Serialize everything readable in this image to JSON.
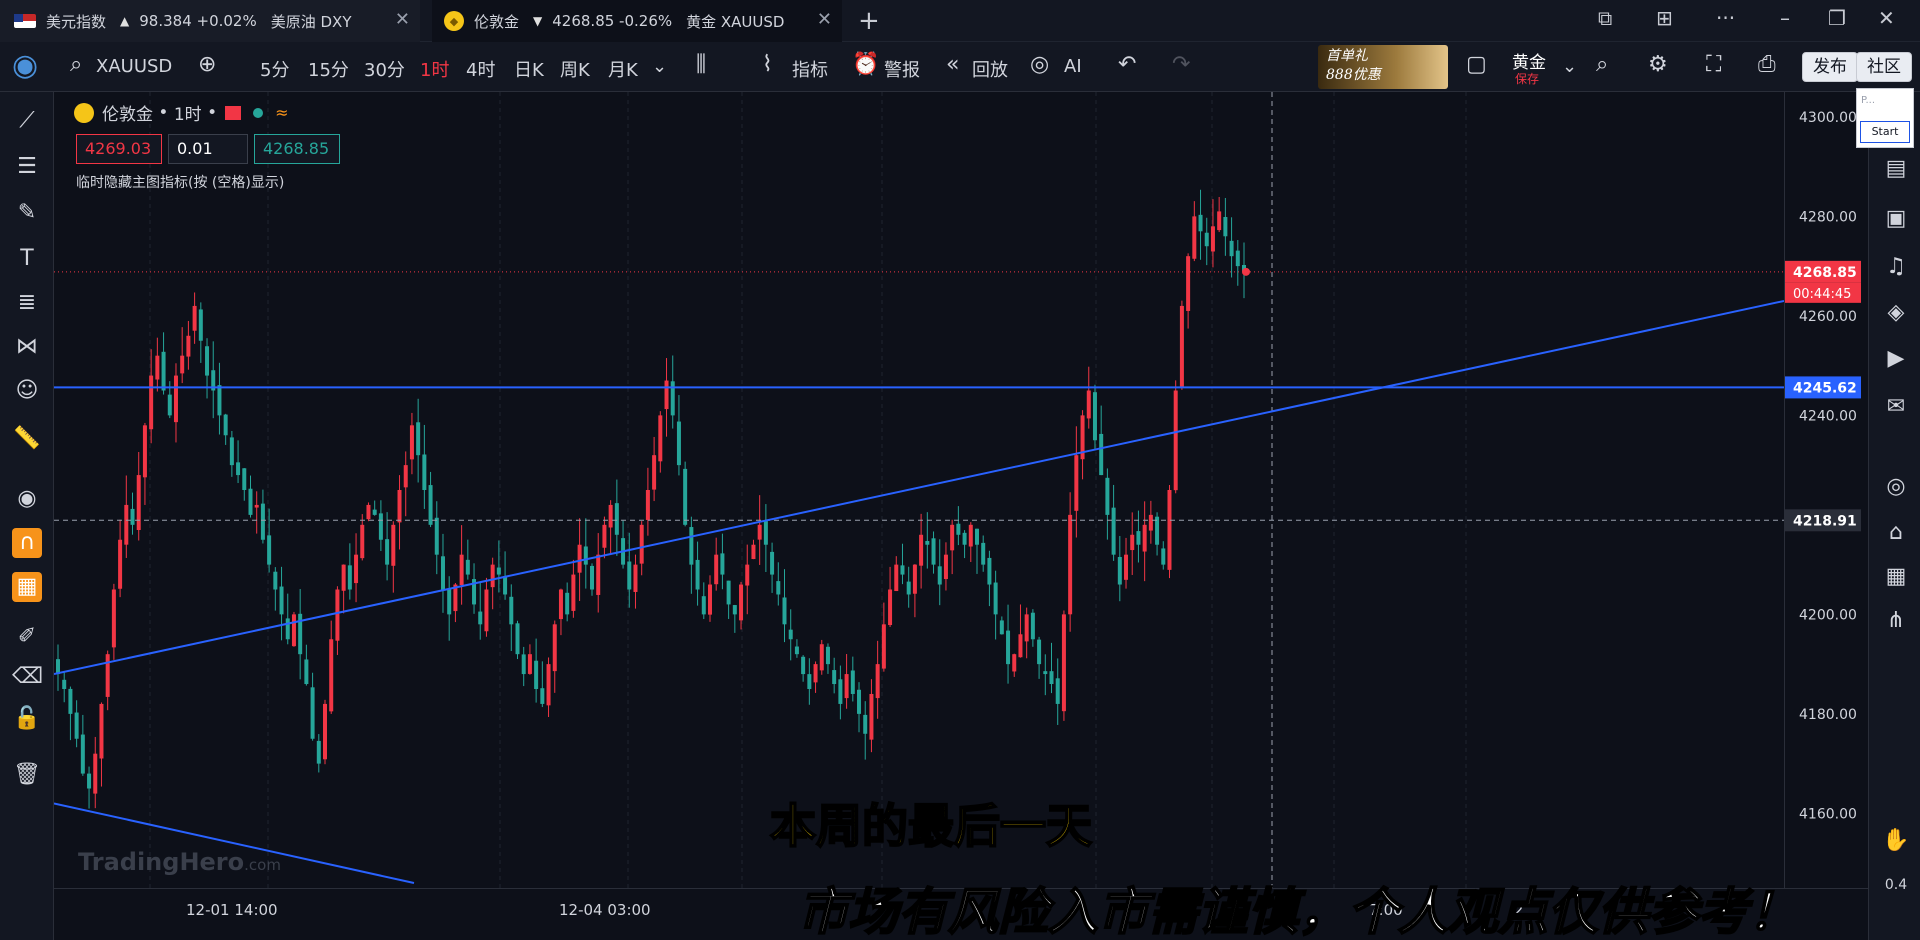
{
  "tabs": [
    {
      "title": "美元指数",
      "arrow": "▲",
      "quote": "98.384 +0.02%",
      "extra": "美原油 DXY"
    },
    {
      "title": "伦敦金",
      "arrow": "▼",
      "quote": "4268.85 -0.26%",
      "extra": "黄金 XAUUSD"
    }
  ],
  "toolbar": {
    "symbol": "XAUUSD",
    "intervals": [
      "5分",
      "15分",
      "30分",
      "1时",
      "4时",
      "日K",
      "周K",
      "月K"
    ],
    "active_interval": "1时",
    "indicators_label": "指标",
    "alerts_label": "警报",
    "replay_label": "回放",
    "ai_label": "AI",
    "promo_line1": "首单礼",
    "promo_line2": "888优惠",
    "layout_name": "黄金",
    "layout_save": "保存",
    "publish_label": "发布",
    "community_label": "社区"
  },
  "legend": {
    "name": "伦敦金",
    "interval": "1时",
    "bid": "4269.03",
    "qty": "0.01",
    "ask": "4268.85",
    "hint": "临时隐藏主图指标(按 (空格)显示)"
  },
  "price_axis": {
    "ticks": [
      "4300.00",
      "4280.00",
      "4260.00",
      "4240.00",
      "4200.00",
      "4180.00",
      "4160.00"
    ],
    "last_price": "4268.85",
    "countdown": "00:44:45",
    "hline_price": "4245.62",
    "crosshair_price": "4218.91"
  },
  "time_axis": {
    "labels": [
      "12-01 14:00",
      "12-04 03:00",
      "7:00",
      "2"
    ]
  },
  "subtitle_yellow": "本周的最后一天",
  "subtitle_white": "市场有风险入市需谨慎，个人观点仅供参考！",
  "watermark": {
    "brand": "TradingHero",
    "suffix": ".com"
  },
  "start_widget": {
    "label": "Start",
    "placeholder": "P..."
  },
  "corner_value": "0.4",
  "colors": {
    "up": "#f23645",
    "down": "#26a69a",
    "trendline": "#2962ff",
    "background": "#0d1019"
  },
  "chart_data": {
    "type": "candlestick",
    "symbol": "XAUUSD",
    "interval": "1H",
    "ylim": [
      4145,
      4305
    ],
    "current_price": 4268.85,
    "horizontal_line": 4245.62,
    "crosshair": 4218.91,
    "x_labels": [
      "12-01 14:00",
      "12-04 03:00"
    ],
    "close_path": [
      4188,
      4185,
      4180,
      4175,
      4168,
      4165,
      4172,
      4182,
      4192,
      4205,
      4215,
      4222,
      4218,
      4228,
      4238,
      4248,
      4252,
      4245,
      4240,
      4248,
      4252,
      4256,
      4262,
      4255,
      4248,
      4245,
      4240,
      4236,
      4230,
      4228,
      4225,
      4220,
      4222,
      4215,
      4210,
      4205,
      4200,
      4195,
      4200,
      4192,
      4186,
      4175,
      4170,
      4182,
      4195,
      4205,
      4210,
      4205,
      4212,
      4218,
      4222,
      4220,
      4215,
      4210,
      4218,
      4225,
      4230,
      4238,
      4232,
      4225,
      4218,
      4212,
      4205,
      4200,
      4206,
      4212,
      4208,
      4202,
      4198,
      4205,
      4210,
      4208,
      4204,
      4198,
      4192,
      4188,
      4192,
      4185,
      4182,
      4190,
      4198,
      4205,
      4200,
      4208,
      4214,
      4210,
      4205,
      4212,
      4218,
      4222,
      4216,
      4210,
      4205,
      4210,
      4218,
      4225,
      4232,
      4240,
      4247,
      4240,
      4230,
      4218,
      4210,
      4205,
      4200,
      4206,
      4212,
      4208,
      4202,
      4200,
      4206,
      4210,
      4214,
      4218,
      4214,
      4208,
      4204,
      4198,
      4195,
      4192,
      4188,
      4185,
      4190,
      4194,
      4190,
      4186,
      4182,
      4188,
      4184,
      4180,
      4176,
      4184,
      4190,
      4198,
      4205,
      4210,
      4208,
      4204,
      4210,
      4216,
      4214,
      4210,
      4206,
      4212,
      4218,
      4216,
      4214,
      4218,
      4214,
      4210,
      4206,
      4200,
      4196,
      4190,
      4192,
      4196,
      4200,
      4195,
      4190,
      4188,
      4186,
      4182,
      4200,
      4220,
      4232,
      4240,
      4245,
      4235,
      4228,
      4220,
      4212,
      4206,
      4212,
      4216,
      4214,
      4218,
      4220,
      4214,
      4210,
      4225,
      4245,
      4262,
      4272,
      4280,
      4277,
      4274,
      4278,
      4281,
      4276,
      4272,
      4270,
      4269
    ]
  }
}
